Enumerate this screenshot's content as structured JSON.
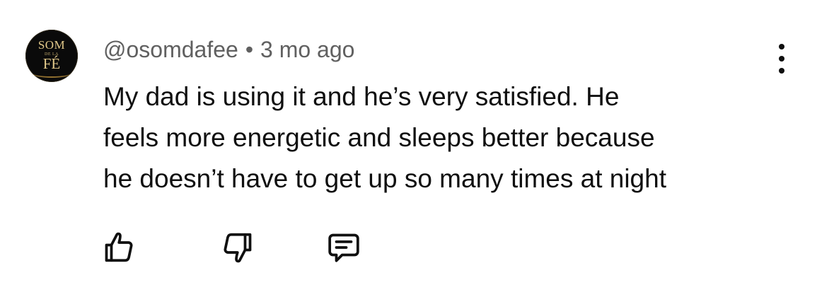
{
  "comment": {
    "avatar": {
      "line1": "SOM",
      "line2": "DE LA",
      "line3": "FÉ",
      "colors": {
        "background": "#0a0a0a",
        "text": "#e2c98a"
      }
    },
    "author": "@osomdafee",
    "separator": "•",
    "time": "3 mo ago",
    "text_lines": [
      "My dad is using it and he’s very satisfied. He",
      "feels more energetic and sleeps better because",
      "he doesn’t have to get up so many times at night"
    ],
    "actions": {
      "like_icon": "thumbs-up-icon",
      "dislike_icon": "thumbs-down-icon",
      "reply_icon": "reply-comment-icon",
      "more_icon": "more-vertical-icon"
    }
  }
}
